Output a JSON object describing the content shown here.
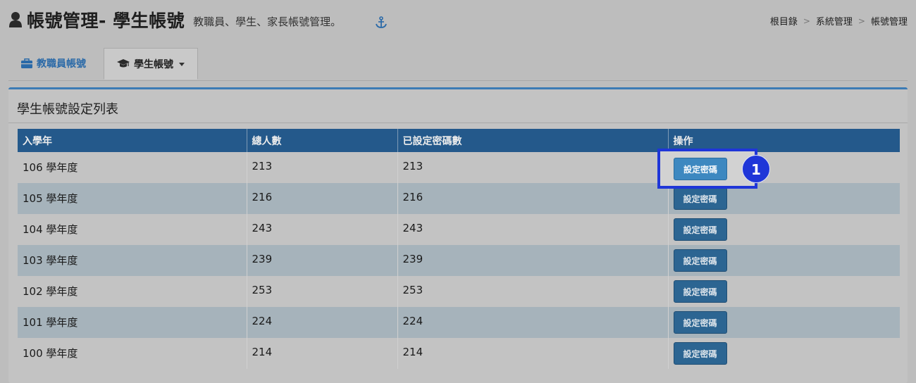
{
  "header": {
    "title": "帳號管理- 學生帳號",
    "subtitle": "教職員、學生、家長帳號管理。",
    "breadcrumb": [
      "根目錄",
      "系統管理",
      "帳號管理"
    ]
  },
  "tabs": [
    {
      "label": "教職員帳號",
      "icon": "briefcase-icon",
      "active": false
    },
    {
      "label": "學生帳號",
      "icon": "graduation-cap-icon",
      "active": true,
      "dropdown": true
    }
  ],
  "panel": {
    "title": "學生帳號設定列表",
    "columns": [
      "入學年",
      "總人數",
      "已設定密碼數",
      "操作"
    ],
    "rows": [
      {
        "year": "106 學年度",
        "total": "213",
        "set": "213",
        "action": "設定密碼"
      },
      {
        "year": "105 學年度",
        "total": "216",
        "set": "216",
        "action": "設定密碼"
      },
      {
        "year": "104 學年度",
        "total": "243",
        "set": "243",
        "action": "設定密碼"
      },
      {
        "year": "103 學年度",
        "total": "239",
        "set": "239",
        "action": "設定密碼"
      },
      {
        "year": "102 學年度",
        "total": "253",
        "set": "253",
        "action": "設定密碼"
      },
      {
        "year": "101 學年度",
        "total": "224",
        "set": "224",
        "action": "設定密碼"
      },
      {
        "year": "100 學年度",
        "total": "214",
        "set": "214",
        "action": "設定密碼"
      }
    ]
  },
  "callout": {
    "step": "1",
    "color": "#1f36d8"
  },
  "colors": {
    "accent": "#3c7bb5",
    "table_header": "#24598b",
    "button": "#2c6592"
  }
}
